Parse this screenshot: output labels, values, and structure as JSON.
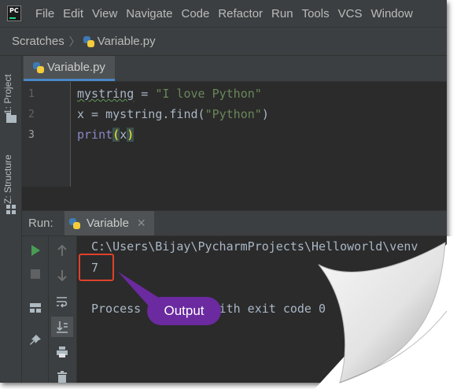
{
  "app": {
    "logo_text": "PC"
  },
  "menu": [
    "File",
    "Edit",
    "View",
    "Navigate",
    "Code",
    "Refactor",
    "Run",
    "Tools",
    "VCS",
    "Window"
  ],
  "breadcrumb": {
    "root": "Scratches",
    "file": "Variable.py"
  },
  "side_tabs": {
    "project": "1: Project",
    "structure": "Z: Structure"
  },
  "editor": {
    "tab_label": "Variable.py",
    "line_numbers": [
      "1",
      "2",
      "3"
    ],
    "lines": {
      "l1_var": "mystring",
      "l1_op": " = ",
      "l1_str": "\"I love Python\"",
      "l2_code": "x = mystring.find(",
      "l2_str": "\"Python\"",
      "l2_end": ")",
      "l3_fn": "print",
      "l3_open": "(",
      "l3_arg": "x",
      "l3_close": ")"
    }
  },
  "run_panel": {
    "label": "Run:",
    "tab_label": "Variable",
    "command": "C:\\Users\\Bijay\\PycharmProjects\\Helloworld\\venv",
    "output_value": "7",
    "exit_text": "Process finished with exit code 0"
  },
  "annotation": {
    "label": "Output",
    "color": "#6b2aa0",
    "highlight_color": "#e0402b"
  },
  "colors": {
    "menubar_bg": "#3c3f41",
    "editor_bg": "#2b2b2b",
    "string": "#6a8759",
    "builtin": "#8888c6",
    "run_green": "#499c54",
    "tab_accent": "#4a88c7"
  }
}
